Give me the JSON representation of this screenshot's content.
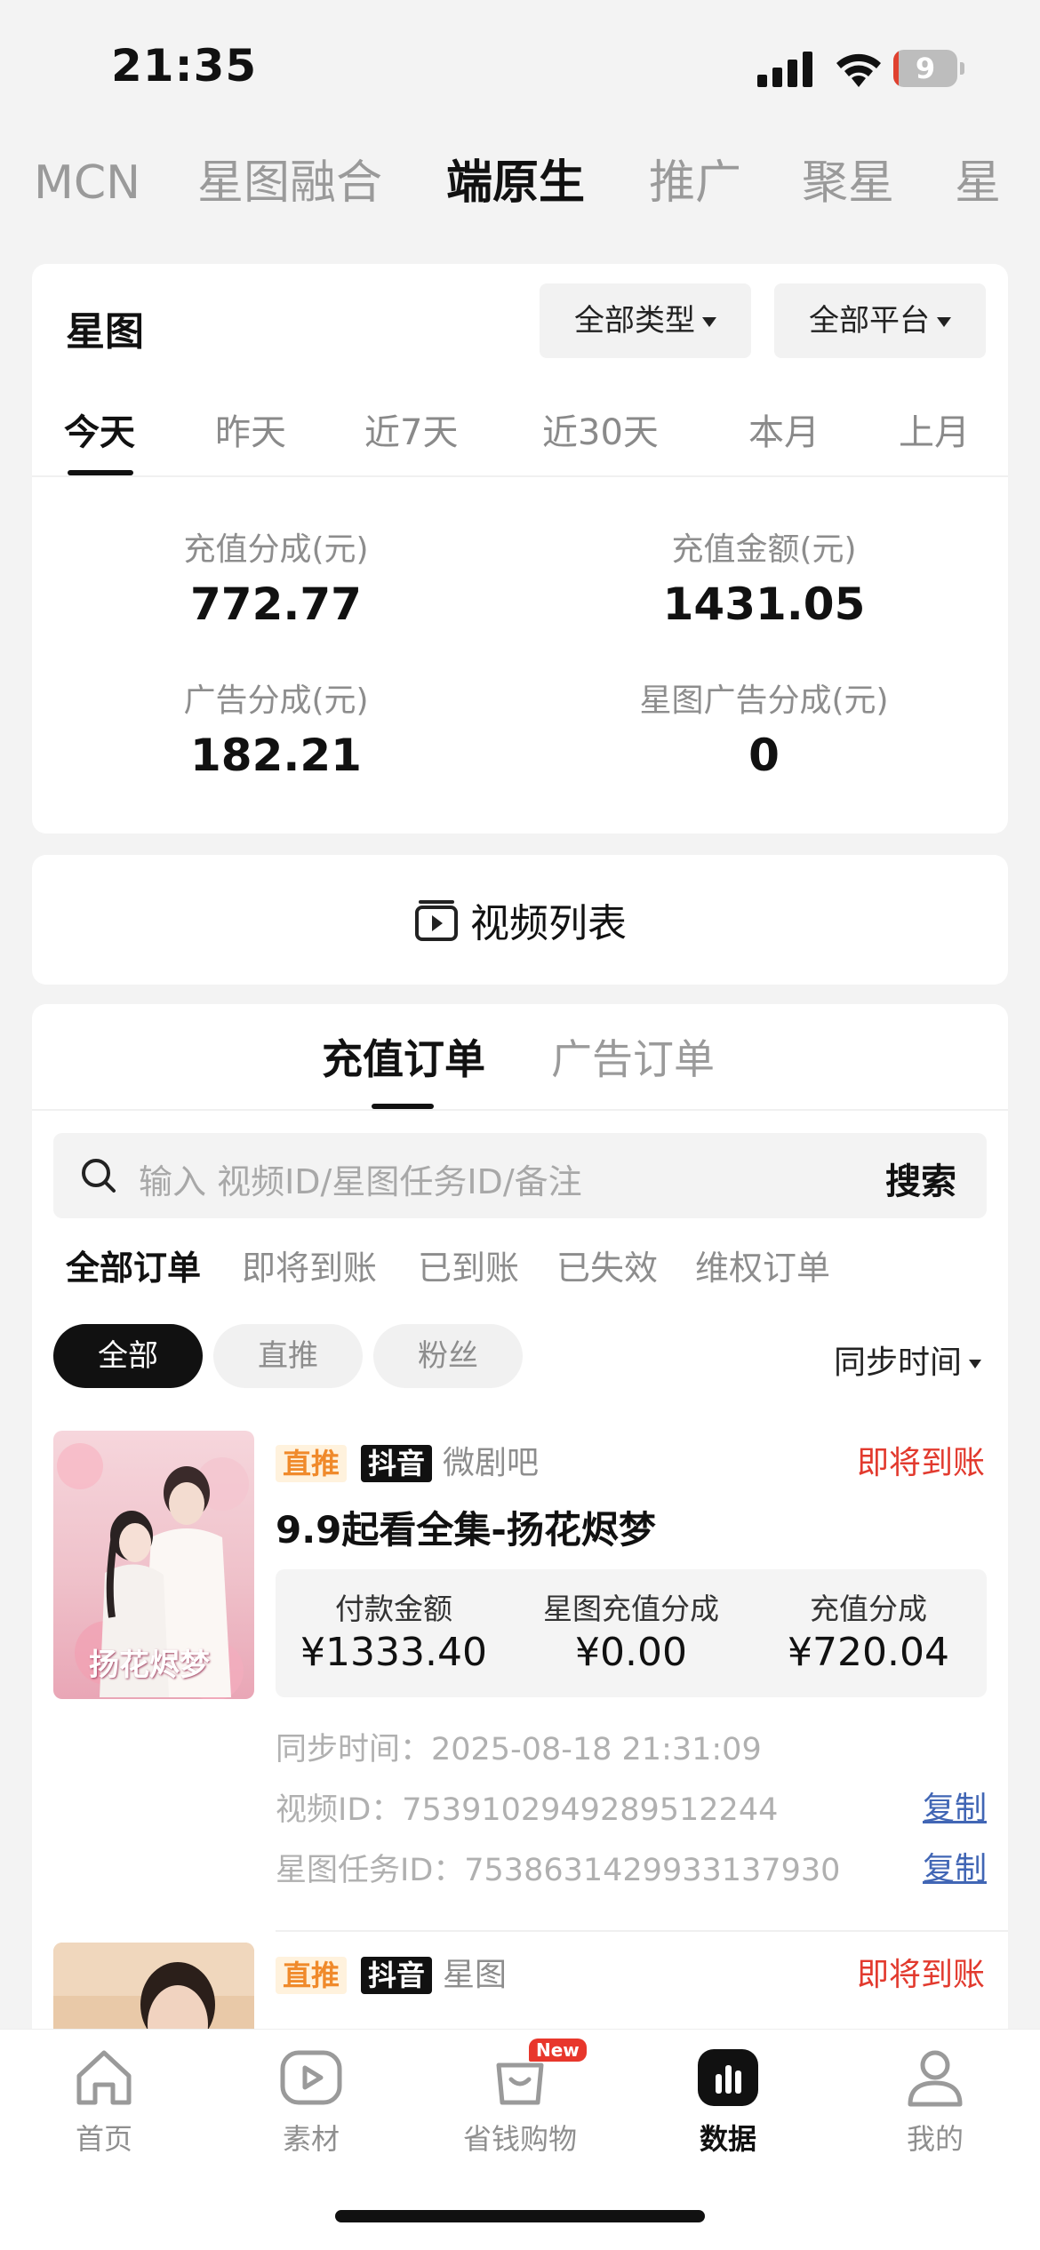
{
  "status_bar": {
    "time": "21:35",
    "battery_level": "9",
    "battery_fraction": 0.09
  },
  "top_tabs": [
    "MCN",
    "星图融合",
    "端原生",
    "推广",
    "聚星",
    "星"
  ],
  "top_tabs_active": "端原生",
  "summary": {
    "title": "星图",
    "filter_type": "全部类型",
    "filter_platform": "全部平台",
    "date_tabs": [
      "今天",
      "昨天",
      "近7天",
      "近30天",
      "本月",
      "上月"
    ],
    "stats": [
      {
        "label": "充值分成(元)",
        "value": "772.77"
      },
      {
        "label": "充值金额(元)",
        "value": "1431.05"
      },
      {
        "label": "广告分成(元)",
        "value": "182.21"
      },
      {
        "label": "星图广告分成(元)",
        "value": "0"
      }
    ]
  },
  "video_list": {
    "label": "视频列表"
  },
  "orders_section": {
    "tabs": [
      "充值订单",
      "广告订单"
    ],
    "search_placeholder": "输入 视频ID/星图任务ID/备注",
    "search_button": "搜索",
    "filter_tabs": [
      "全部订单",
      "即将到账",
      "已到账",
      "已失效",
      "维权订单"
    ],
    "pills": [
      "全部",
      "直推",
      "粉丝"
    ],
    "sort_label": "同步时间",
    "orders": [
      {
        "tag_type": "直推",
        "tag_platform": "抖音",
        "source": "微剧吧",
        "status": "即将到账",
        "title": "9.9起看全集-扬花烬梦",
        "poster_text": "扬花烬梦",
        "amounts": [
          {
            "label": "付款金额",
            "value": "¥1333.40"
          },
          {
            "label": "星图充值分成",
            "value": "¥0.00"
          },
          {
            "label": "充值分成",
            "value": "¥720.04"
          }
        ],
        "sync_time": "同步时间：2025-08-18 21:31:09",
        "video_id": "视频ID：7539102949289512244",
        "task_id": "星图任务ID：7538631429933137930",
        "copy_label": "复制"
      },
      {
        "tag_type": "直推",
        "tag_platform": "抖音",
        "source": "星图",
        "status": "即将到账"
      }
    ]
  },
  "bottom_nav": [
    {
      "label": "首页",
      "icon": "home-icon"
    },
    {
      "label": "素材",
      "icon": "play-icon"
    },
    {
      "label": "省钱购物",
      "icon": "shopping-bag-icon",
      "badge": "New"
    },
    {
      "label": "数据",
      "icon": "bar-chart-icon"
    },
    {
      "label": "我的",
      "icon": "user-icon"
    }
  ],
  "colors": {
    "accent_red": "#e23a2e",
    "tag_orange": "#f08a2b",
    "link_blue": "#4166b5"
  }
}
